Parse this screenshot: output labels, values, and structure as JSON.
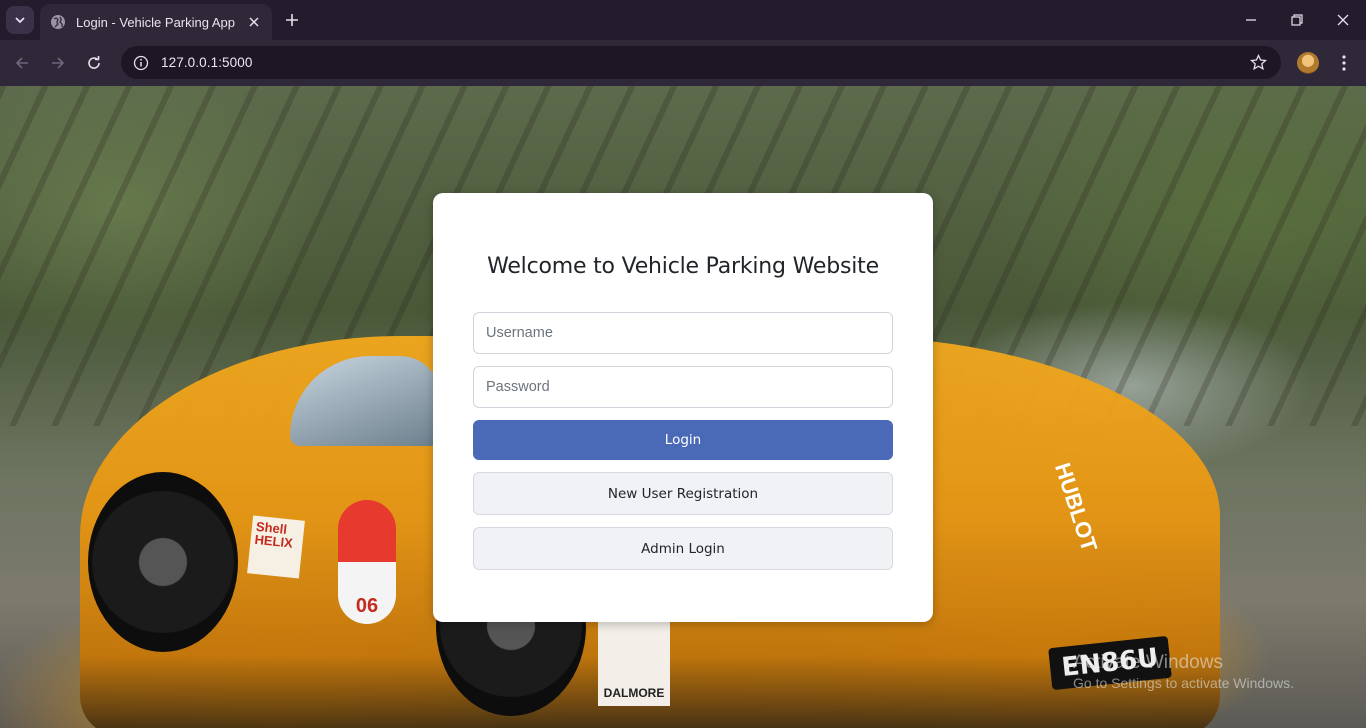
{
  "browser": {
    "tab_title": "Login - Vehicle Parking App",
    "url": "127.0.0.1:5000",
    "icons": {
      "tab_search": "chevron-down-icon",
      "favicon": "globe-icon",
      "tab_close": "close-icon",
      "new_tab": "plus-icon",
      "back": "arrow-left-icon",
      "forward": "arrow-right-icon",
      "reload": "reload-icon",
      "site_info": "info-icon",
      "bookmark": "star-icon",
      "profile": "avatar",
      "menu": "kebab-menu-icon",
      "minimize": "minimize-icon",
      "restore": "restore-icon",
      "close_window": "close-icon"
    }
  },
  "page": {
    "background": "photo of an orange sports car on a tree-lined road",
    "decals": {
      "helix": "Shell HELIX",
      "number": "06",
      "dalmore": "DALMORE",
      "hublot": "HUBLOT",
      "plate": "EN86U"
    }
  },
  "login": {
    "title": "Welcome to Vehicle Parking Website",
    "username_placeholder": "Username",
    "password_placeholder": "Password",
    "login_label": "Login",
    "register_label": "New User Registration",
    "admin_label": "Admin Login",
    "colors": {
      "primary": "#4a6ab8",
      "secondary_bg": "#f0f2f5",
      "card_bg": "#ffffff"
    }
  },
  "watermark": {
    "title": "Activate Windows",
    "subtitle": "Go to Settings to activate Windows."
  }
}
